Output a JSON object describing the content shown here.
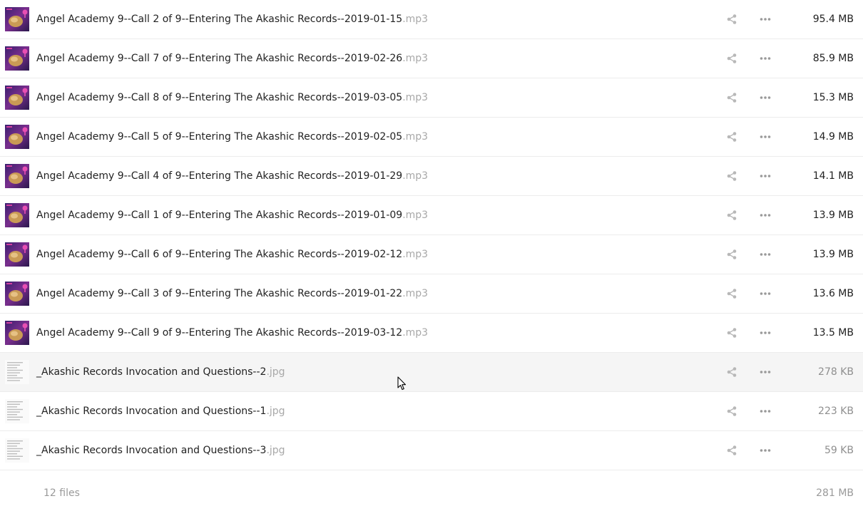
{
  "files": [
    {
      "name": "Angel Academy 9--Call 2 of 9--Entering The Akashic Records--2019-01-15",
      "ext": ".mp3",
      "size": "95.4 MB",
      "thumb": "audio-cover"
    },
    {
      "name": "Angel Academy 9--Call 7 of 9--Entering The Akashic Records--2019-02-26",
      "ext": ".mp3",
      "size": "85.9 MB",
      "thumb": "audio-cover"
    },
    {
      "name": "Angel Academy 9--Call 8 of 9--Entering The Akashic Records--2019-03-05",
      "ext": ".mp3",
      "size": "15.3 MB",
      "thumb": "audio-cover"
    },
    {
      "name": "Angel Academy 9--Call 5 of 9--Entering The Akashic Records--2019-02-05",
      "ext": ".mp3",
      "size": "14.9 MB",
      "thumb": "audio-cover"
    },
    {
      "name": "Angel Academy 9--Call 4 of 9--Entering The Akashic Records--2019-01-29",
      "ext": ".mp3",
      "size": "14.1 MB",
      "thumb": "audio-cover"
    },
    {
      "name": "Angel Academy 9--Call 1 of 9--Entering The Akashic Records--2019-01-09",
      "ext": ".mp3",
      "size": "13.9 MB",
      "thumb": "audio-cover"
    },
    {
      "name": "Angel Academy 9--Call 6 of 9--Entering The Akashic Records--2019-02-12",
      "ext": ".mp3",
      "size": "13.9 MB",
      "thumb": "audio-cover"
    },
    {
      "name": "Angel Academy 9--Call 3 of 9--Entering The Akashic Records--2019-01-22",
      "ext": ".mp3",
      "size": "13.6 MB",
      "thumb": "audio-cover"
    },
    {
      "name": "Angel Academy 9--Call 9 of 9--Entering The Akashic Records--2019-03-12",
      "ext": ".mp3",
      "size": "13.5 MB",
      "thumb": "audio-cover"
    },
    {
      "name": "_Akashic Records Invocation and Questions--2",
      "ext": ".jpg",
      "size": "278 KB",
      "thumb": "document-preview",
      "hovered": true
    },
    {
      "name": "_Akashic Records Invocation and Questions--1",
      "ext": ".jpg",
      "size": "223 KB",
      "thumb": "document-preview"
    },
    {
      "name": "_Akashic Records Invocation and Questions--3",
      "ext": ".jpg",
      "size": "59 KB",
      "thumb": "document-preview"
    }
  ],
  "summary": {
    "count_label": "12 files",
    "total_size": "281 MB"
  },
  "icons": {
    "share": "share-icon",
    "more": "more-options-icon",
    "cursor": "mouse-pointer-icon"
  },
  "colors": {
    "text": "#222222",
    "muted": "#a8a8a8",
    "icon": "#b8b8b8",
    "row_hover": "#f5f5f5",
    "divider": "#ececec"
  }
}
